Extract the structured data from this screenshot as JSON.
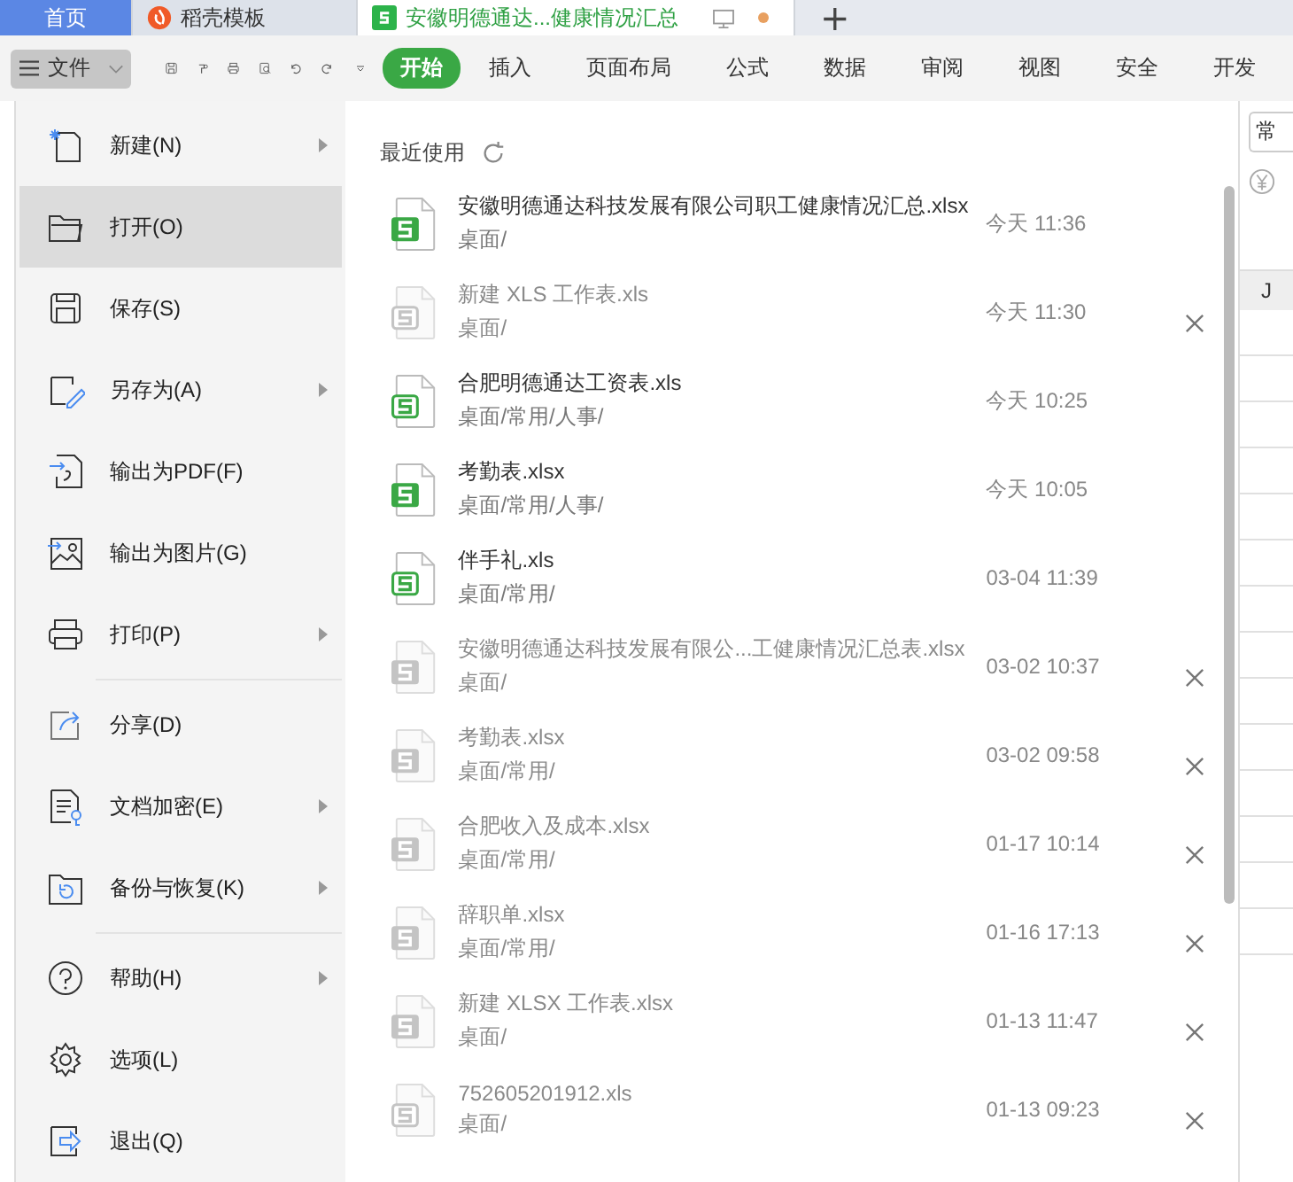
{
  "tabs": [
    {
      "label": "首页",
      "selected": false,
      "kind": "home"
    },
    {
      "label": "稻壳模板",
      "selected": false,
      "kind": "template"
    },
    {
      "label": "安徽明德通达...健康情况汇总",
      "selected": true,
      "kind": "document",
      "unsaved": true
    }
  ],
  "new_tab": "+",
  "toolbar": {
    "file_menu": "文件",
    "ribbon_tabs": [
      {
        "label": "开始",
        "selected": true
      },
      {
        "label": "插入",
        "selected": false
      },
      {
        "label": "页面布局",
        "selected": false
      },
      {
        "label": "公式",
        "selected": false
      },
      {
        "label": "数据",
        "selected": false
      },
      {
        "label": "审阅",
        "selected": false
      },
      {
        "label": "视图",
        "selected": false
      },
      {
        "label": "安全",
        "selected": false
      },
      {
        "label": "开发",
        "selected": false
      }
    ]
  },
  "file_menu": {
    "items": [
      {
        "label": "新建(N)",
        "selected": false,
        "submenu": true,
        "separator_after": false
      },
      {
        "label": "打开(O)",
        "selected": true,
        "submenu": false,
        "separator_after": false
      },
      {
        "label": "保存(S)",
        "selected": false,
        "submenu": false,
        "separator_after": false
      },
      {
        "label": "另存为(A)",
        "selected": false,
        "submenu": true,
        "separator_after": false
      },
      {
        "label": "输出为PDF(F)",
        "selected": false,
        "submenu": false,
        "separator_after": false
      },
      {
        "label": "输出为图片(G)",
        "selected": false,
        "submenu": false,
        "separator_after": false
      },
      {
        "label": "打印(P)",
        "selected": false,
        "submenu": true,
        "separator_after": true
      },
      {
        "label": "分享(D)",
        "selected": false,
        "submenu": false,
        "separator_after": false
      },
      {
        "label": "文档加密(E)",
        "selected": false,
        "submenu": true,
        "separator_after": false
      },
      {
        "label": "备份与恢复(K)",
        "selected": false,
        "submenu": true,
        "separator_after": true
      },
      {
        "label": "帮助(H)",
        "selected": false,
        "submenu": true,
        "separator_after": false
      },
      {
        "label": "选项(L)",
        "selected": false,
        "submenu": false,
        "separator_after": false
      },
      {
        "label": "退出(Q)",
        "selected": false,
        "submenu": false,
        "separator_after": false
      }
    ]
  },
  "recent": {
    "title": "最近使用",
    "files": [
      {
        "name": "安徽明德通达科技发展有限公司职工健康情况汇总.xlsx",
        "path": "桌面/",
        "time": "今天 11:36",
        "kind": "xlsx",
        "missing": false
      },
      {
        "name": "新建 XLS 工作表.xls",
        "path": "桌面/",
        "time": "今天 11:30",
        "kind": "xls",
        "missing": true
      },
      {
        "name": "合肥明德通达工资表.xls",
        "path": "桌面/常用/人事/",
        "time": "今天 10:25",
        "kind": "xls",
        "missing": false
      },
      {
        "name": "考勤表.xlsx",
        "path": "桌面/常用/人事/",
        "time": "今天 10:05",
        "kind": "xlsx",
        "missing": false
      },
      {
        "name": "伴手礼.xls",
        "path": "桌面/常用/",
        "time": "03-04 11:39",
        "kind": "xls",
        "missing": false
      },
      {
        "name": "安徽明德通达科技发展有限公...工健康情况汇总表.xlsx",
        "path": "桌面/",
        "time": "03-02 10:37",
        "kind": "xlsx",
        "missing": true
      },
      {
        "name": "考勤表.xlsx",
        "path": "桌面/常用/",
        "time": "03-02 09:58",
        "kind": "xlsx",
        "missing": true
      },
      {
        "name": "合肥收入及成本.xlsx",
        "path": "桌面/常用/",
        "time": "01-17 10:14",
        "kind": "xlsx",
        "missing": true
      },
      {
        "name": "辞职单.xlsx",
        "path": "桌面/常用/",
        "time": "01-16 17:13",
        "kind": "xlsx",
        "missing": true
      },
      {
        "name": "新建 XLSX 工作表.xlsx",
        "path": "桌面/",
        "time": "01-13 11:47",
        "kind": "xlsx",
        "missing": true
      },
      {
        "name": "752605201912.xls",
        "path": "桌面/",
        "time": "01-13 09:23",
        "kind": "xls",
        "missing": true
      }
    ]
  },
  "sheet": {
    "number_format": "常",
    "column_header": "J"
  }
}
